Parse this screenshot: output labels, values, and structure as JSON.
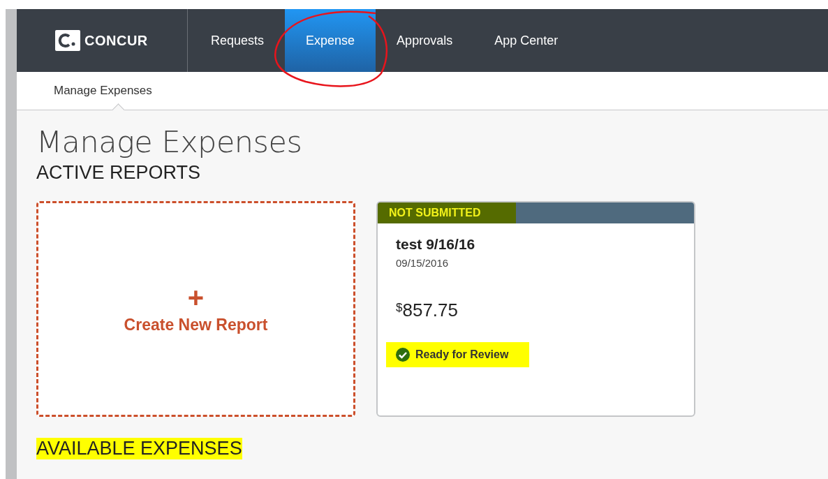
{
  "nav": {
    "logo": "CONCUR",
    "tabs": [
      {
        "label": "Requests",
        "selected": false,
        "circled": false
      },
      {
        "label": "Expense",
        "selected": true,
        "circled": true
      },
      {
        "label": "Approvals",
        "selected": false,
        "circled": false
      },
      {
        "label": "App Center",
        "selected": false,
        "circled": false
      }
    ]
  },
  "subnav": {
    "items": [
      {
        "label": "Manage Expenses",
        "selected": true
      }
    ]
  },
  "page_title": "Manage Expenses",
  "active_reports": {
    "heading": "ACTIVE REPORTS",
    "highlighted": false,
    "create": {
      "icon": "+",
      "label": "Create New Report"
    },
    "reports": [
      {
        "status": "NOT SUBMITTED",
        "status_highlighted": true,
        "name": "test 9/16/16",
        "date": "09/15/2016",
        "currency": "$",
        "amount": "857.75",
        "alert": "Ready for Review",
        "alert_highlighted": true
      }
    ]
  },
  "available_expenses": {
    "heading": "AVAILABLE EXPENSES",
    "highlighted": true
  }
}
